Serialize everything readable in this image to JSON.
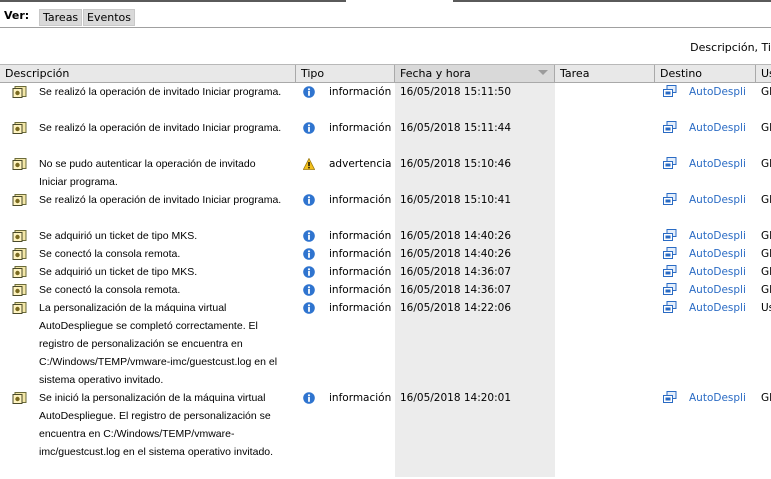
{
  "toolbar": {
    "ver_label": "Ver:",
    "tab_tareas": "Tareas",
    "tab_eventos": "Eventos",
    "filter_text": "Descripción, Ti"
  },
  "columns": {
    "descripcion": "Descripción",
    "tipo": "Tipo",
    "fecha": "Fecha y hora",
    "tarea": "Tarea",
    "destino": "Destino",
    "usuario": "Us"
  },
  "rows": [
    {
      "descripcion": "Se realizó la operación de invitado Iniciar programa.",
      "tipo": "información",
      "tipo_icon": "info-icon",
      "fecha": "16/05/2018 15:11:50",
      "destino": "AutoDespli",
      "usuario": "GI"
    },
    {
      "descripcion": "Se realizó la operación de invitado Iniciar programa.",
      "tipo": "información",
      "tipo_icon": "info-icon",
      "fecha": "16/05/2018 15:11:44",
      "destino": "AutoDespli",
      "usuario": "GI"
    },
    {
      "descripcion": "No se pudo autenticar la operación de invitado Iniciar programa.",
      "tipo": "advertencia",
      "tipo_icon": "warning-icon",
      "fecha": "16/05/2018 15:10:46",
      "destino": "AutoDespli",
      "usuario": "GI"
    },
    {
      "descripcion": "Se realizó la operación de invitado Iniciar programa.",
      "tipo": "información",
      "tipo_icon": "info-icon",
      "fecha": "16/05/2018 15:10:41",
      "destino": "AutoDespli",
      "usuario": "GI"
    },
    {
      "descripcion": "Se adquirió un ticket de tipo MKS.",
      "tipo": "información",
      "tipo_icon": "info-icon",
      "fecha": "16/05/2018 14:40:26",
      "destino": "AutoDespli",
      "usuario": "GI"
    },
    {
      "descripcion": "Se conectó la consola remota.",
      "tipo": "información",
      "tipo_icon": "info-icon",
      "fecha": "16/05/2018 14:40:26",
      "destino": "AutoDespli",
      "usuario": "GI"
    },
    {
      "descripcion": "Se adquirió un ticket de tipo MKS.",
      "tipo": "información",
      "tipo_icon": "info-icon",
      "fecha": "16/05/2018 14:36:07",
      "destino": "AutoDespli",
      "usuario": "GI"
    },
    {
      "descripcion": "Se conectó la consola remota.",
      "tipo": "información",
      "tipo_icon": "info-icon",
      "fecha": "16/05/2018 14:36:07",
      "destino": "AutoDespli",
      "usuario": "GI"
    },
    {
      "descripcion": "La personalización de la máquina virtual AutoDespliegue se completó correctamente. El registro de personalización se encuentra en C:/Windows/TEMP/vmware-imc/guestcust.log en el sistema operativo invitado.",
      "tipo": "información",
      "tipo_icon": "info-icon",
      "fecha": "16/05/2018 14:22:06",
      "destino": "AutoDespli",
      "usuario": "Us"
    },
    {
      "descripcion": "Se inició la personalización de la máquina virtual AutoDespliegue. El registro de personalización se encuentra en C:/Windows/TEMP/vmware-imc/guestcust.log en el sistema operativo invitado.",
      "tipo": "información",
      "tipo_icon": "info-icon",
      "fecha": "16/05/2018 14:20:01",
      "destino": "AutoDespli",
      "usuario": "GI"
    }
  ]
}
